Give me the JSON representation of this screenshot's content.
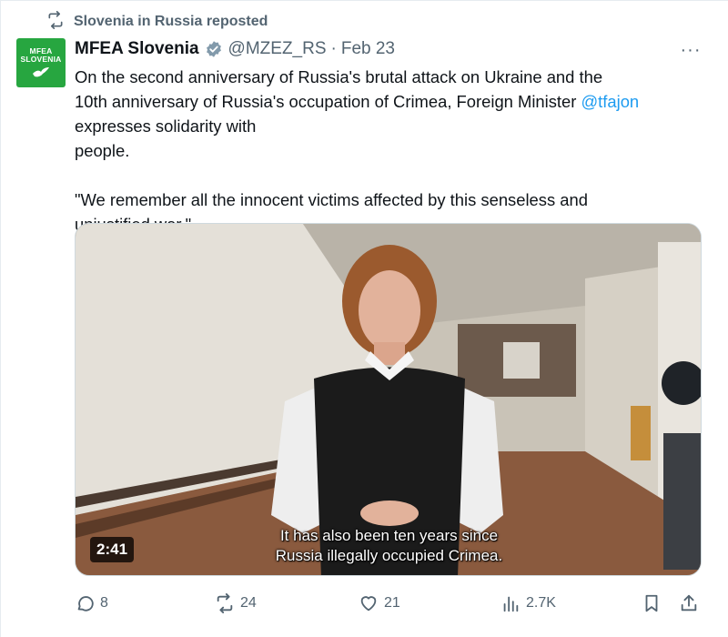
{
  "repost": {
    "icon": "repost-icon",
    "text": "Slovenia in Russia reposted"
  },
  "author": {
    "avatar_line1": "MFEA",
    "avatar_line2": "SLOVENIA",
    "avatar_color": "#27a640",
    "name": "MFEA Slovenia",
    "verified_icon": "verified-badge-icon",
    "handle": "@MZEZ_RS",
    "separator": "·",
    "date": "Feb 23"
  },
  "more_label": "···",
  "text": {
    "line1": "On the second anniversary of Russia's brutal attack on Ukraine and the",
    "line2_pre": "10th anniversary of Russia's occupation of Crimea, Foreign Minister ",
    "mention": "@tfajon",
    "line3_pre": "expresses solidarity with",
    "flag": "ukraine-flag",
    "line3_post": "people.",
    "quote_line1": "\"We remember all the innocent victims affected by this senseless and",
    "quote_line2": "unjustified war.\""
  },
  "video": {
    "duration": "2:41",
    "subtitle_line1": "It has also been ten years since",
    "subtitle_line2": "Russia illegally occupied Crimea."
  },
  "actions": {
    "reply_count": "8",
    "repost_count": "24",
    "like_count": "21",
    "views_count": "2.7K"
  },
  "colors": {
    "link": "#1d9bf0",
    "secondary_text": "#536471",
    "primary_text": "#0f1419"
  }
}
